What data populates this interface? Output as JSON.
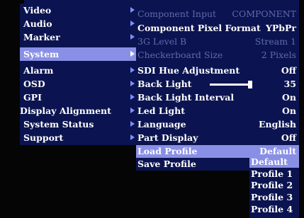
{
  "left_menu": {
    "items": [
      {
        "label": "Video"
      },
      {
        "label": "Audio"
      },
      {
        "label": "Marker"
      },
      {
        "label": "System"
      },
      {
        "label": "Alarm"
      },
      {
        "label": "OSD"
      },
      {
        "label": "GPI"
      },
      {
        "label": "Display Alignment"
      },
      {
        "label": "System Status"
      },
      {
        "label": "Support"
      }
    ],
    "selected_index": 3
  },
  "system_menu": {
    "items": [
      {
        "label": "Component Input",
        "value": "COMPONENT",
        "disabled": true
      },
      {
        "label": "Component Pixel Format",
        "value": "YPbPr",
        "disabled": false
      },
      {
        "label": "3G Level B",
        "value": "Stream 1",
        "disabled": true
      },
      {
        "label": "Checkerboard Size",
        "value": "2 Pixels",
        "disabled": true
      },
      {
        "label": "SDI Hue Adjustment",
        "value": "Off",
        "disabled": false
      },
      {
        "label": "Back Light",
        "value": "35",
        "disabled": false,
        "slider_fraction": 0.95
      },
      {
        "label": "Back Light Interval",
        "value": "On",
        "disabled": false
      },
      {
        "label": "Led Light",
        "value": "On",
        "disabled": false
      },
      {
        "label": "Language",
        "value": "English",
        "disabled": false
      },
      {
        "label": "Part Display",
        "value": "Off",
        "disabled": false
      }
    ],
    "load_profile": {
      "label": "Load Profile",
      "value": "Default"
    },
    "save_profile": {
      "label": "Save Profile"
    }
  },
  "profile_dropdown": {
    "options": [
      "Default",
      "Profile 1",
      "Profile 2",
      "Profile 3",
      "Profile 4"
    ],
    "selected_index": 0
  },
  "colors": {
    "panel_bg": "#0b1450",
    "highlight": "#8a8fe6",
    "disabled_text": "#5f6ab0",
    "arrow": "#7f8fff"
  }
}
